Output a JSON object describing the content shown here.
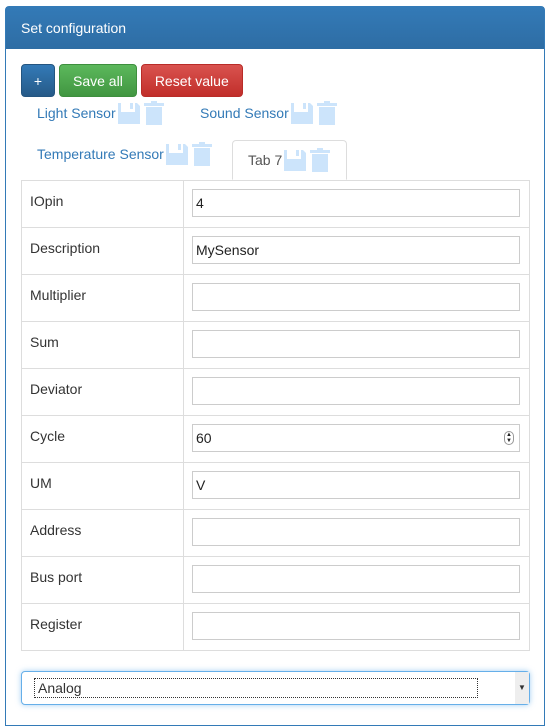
{
  "panel": {
    "title": "Set configuration"
  },
  "toolbar": {
    "add_label": "+",
    "save_all_label": "Save all",
    "reset_label": "Reset value"
  },
  "tabs": [
    {
      "label": "Light Sensor",
      "active": false
    },
    {
      "label": "Sound Sensor",
      "active": false
    },
    {
      "label": "Temperature Sensor",
      "active": false
    },
    {
      "label": "Tab 7",
      "active": true
    }
  ],
  "icon_color": "#cce4fb",
  "fields": [
    {
      "label": "IOpin",
      "value": "4"
    },
    {
      "label": "Description",
      "value": "MySensor"
    },
    {
      "label": "Multiplier",
      "value": ""
    },
    {
      "label": "Sum",
      "value": ""
    },
    {
      "label": "Deviator",
      "value": ""
    },
    {
      "label": "Cycle",
      "value": "60"
    },
    {
      "label": "UM",
      "value": "V"
    },
    {
      "label": "Address",
      "value": ""
    },
    {
      "label": "Bus port",
      "value": ""
    },
    {
      "label": "Register",
      "value": ""
    }
  ],
  "type_select": {
    "value": "Analog"
  }
}
